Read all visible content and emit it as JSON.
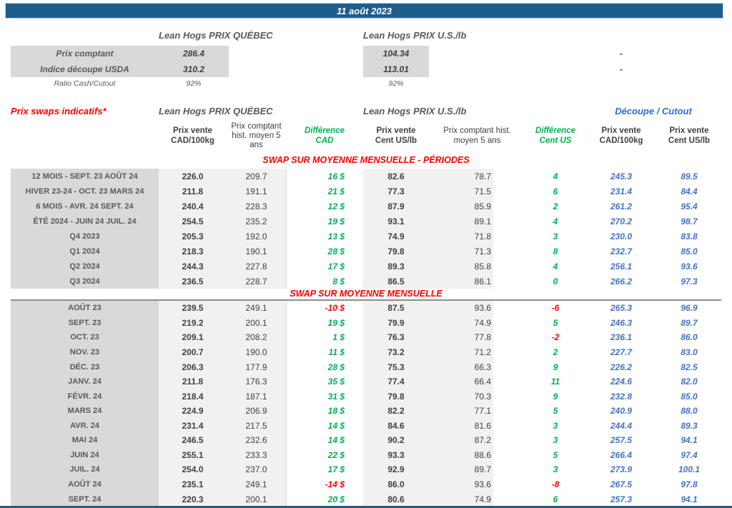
{
  "page": {
    "date_header": "11 août 2023"
  },
  "colors": {
    "header_bar": "#1F5D8D",
    "accent_red": "#FF0000",
    "accent_green": "#00B050",
    "accent_blue": "#4472C4",
    "cutout_header_blue": "#2E6BD6",
    "label_gray": "#D9D9D9",
    "band_gray": "#F1F1F1"
  },
  "spot": {
    "qc_title": "Lean Hogs PRIX QUÉBEC",
    "us_title": "Lean Hogs PRIX U.S./lb",
    "rows": [
      {
        "label": "Prix comptant",
        "qc": "286.4",
        "us": "104.34",
        "cutout": "-"
      },
      {
        "label": "Indice découpe USDA",
        "qc": "310.2",
        "us": "113.01",
        "cutout": "-"
      },
      {
        "label": "Ratio Cash/Cutout",
        "qc": "92%",
        "us": "92%",
        "cutout": ""
      }
    ]
  },
  "swaps": {
    "title": "Prix swaps indicatifs*",
    "qc_title": "Lean Hogs PRIX QUÉBEC",
    "us_title": "Lean Hogs PRIX U.S./lb",
    "cutout_title": "Découpe / Cutout",
    "columns": {
      "qc_sell": "Prix vente\nCAD/100kg",
      "qc_hist": "Prix comptant\nhist. moyen 5\nans",
      "diff_cad": "Différence\nCAD",
      "us_sell": "Prix vente\nCent US/lb",
      "us_hist": "Prix comptant hist.\nmoyen 5 ans",
      "diff_us": "Différence\nCent US",
      "cut_cad": "Prix vente\nCAD/100kg",
      "cut_us": "Prix vente\nCent US/lb"
    },
    "sections": [
      {
        "title": "SWAP SUR MOYENNE MENSUELLE - PÉRIODES",
        "rows": [
          [
            "12 MOIS - SEPT. 23 AOÛT 24",
            "226.0",
            "209.7",
            "16 $",
            "82.6",
            "78.7",
            "4",
            "245.3",
            "89.5"
          ],
          [
            "HIVER 23-24 -  OCT. 23 MARS 24",
            "211.8",
            "191.1",
            "21 $",
            "77.3",
            "71.5",
            "6",
            "231.4",
            "84.4"
          ],
          [
            "6 MOIS -  AVR. 24 SEPT. 24",
            "240.4",
            "228.3",
            "12 $",
            "87.9",
            "85.9",
            "2",
            "261.2",
            "95.4"
          ],
          [
            "ÉTÉ 2024 - JUIN 24 JUIL. 24",
            "254.5",
            "235.2",
            "19 $",
            "93.1",
            "89.1",
            "4",
            "270.2",
            "98.7"
          ],
          [
            "Q4 2023",
            "205.3",
            "192.0",
            "13 $",
            "74.9",
            "71.8",
            "3",
            "230.0",
            "83.8"
          ],
          [
            "Q1 2024",
            "218.3",
            "190.1",
            "28 $",
            "79.8",
            "71.3",
            "8",
            "232.7",
            "85.0"
          ],
          [
            "Q2 2024",
            "244.3",
            "227.8",
            "17 $",
            "89.3",
            "85.8",
            "4",
            "256.1",
            "93.6"
          ],
          [
            "Q3 2024",
            "236.5",
            "228.7",
            "8 $",
            "86.5",
            "86.1",
            "0",
            "266.2",
            "97.3"
          ]
        ]
      },
      {
        "title": "SWAP SUR MOYENNE MENSUELLE",
        "rows": [
          [
            "AOÛT 23",
            "239.5",
            "249.1",
            "-10 $",
            "87.5",
            "93.6",
            "-6",
            "265.3",
            "96.9"
          ],
          [
            "SEPT. 23",
            "219.2",
            "200.1",
            "19 $",
            "79.9",
            "74.9",
            "5",
            "246.3",
            "89.7"
          ],
          [
            "OCT. 23",
            "209.1",
            "208.2",
            "1 $",
            "76.3",
            "77.8",
            "-2",
            "236.1",
            "86.0"
          ],
          [
            "NOV. 23",
            "200.7",
            "190.0",
            "11 $",
            "73.2",
            "71.2",
            "2",
            "227.7",
            "83.0"
          ],
          [
            "DÉC. 23",
            "206.3",
            "177.9",
            "28 $",
            "75.3",
            "66.3",
            "9",
            "226.2",
            "82.5"
          ],
          [
            "JANV. 24",
            "211.8",
            "176.3",
            "35 $",
            "77.4",
            "66.4",
            "11",
            "224.6",
            "82.0"
          ],
          [
            "FÉVR. 24",
            "218.4",
            "187.1",
            "31 $",
            "79.8",
            "70.3",
            "9",
            "232.8",
            "85.0"
          ],
          [
            "MARS 24",
            "224.9",
            "206.9",
            "18 $",
            "82.2",
            "77.1",
            "5",
            "240.9",
            "88.0"
          ],
          [
            "AVR. 24",
            "231.4",
            "217.5",
            "14 $",
            "84.6",
            "81.6",
            "3",
            "244.4",
            "89.3"
          ],
          [
            "MAI 24",
            "246.5",
            "232.6",
            "14 $",
            "90.2",
            "87.2",
            "3",
            "257.5",
            "94.1"
          ],
          [
            "JUIN 24",
            "255.1",
            "233.3",
            "22 $",
            "93.3",
            "88.6",
            "5",
            "266.4",
            "97.4"
          ],
          [
            "JUIL. 24",
            "254.0",
            "237.0",
            "17 $",
            "92.9",
            "89.7",
            "3",
            "273.9",
            "100.1"
          ],
          [
            "AOÛT 24",
            "235.1",
            "249.1",
            "-14 $",
            "86.0",
            "93.6",
            "-8",
            "267.5",
            "97.8"
          ],
          [
            "SEPT. 24",
            "220.3",
            "200.1",
            "20 $",
            "80.6",
            "74.9",
            "6",
            "257.3",
            "94.1"
          ]
        ]
      }
    ]
  }
}
